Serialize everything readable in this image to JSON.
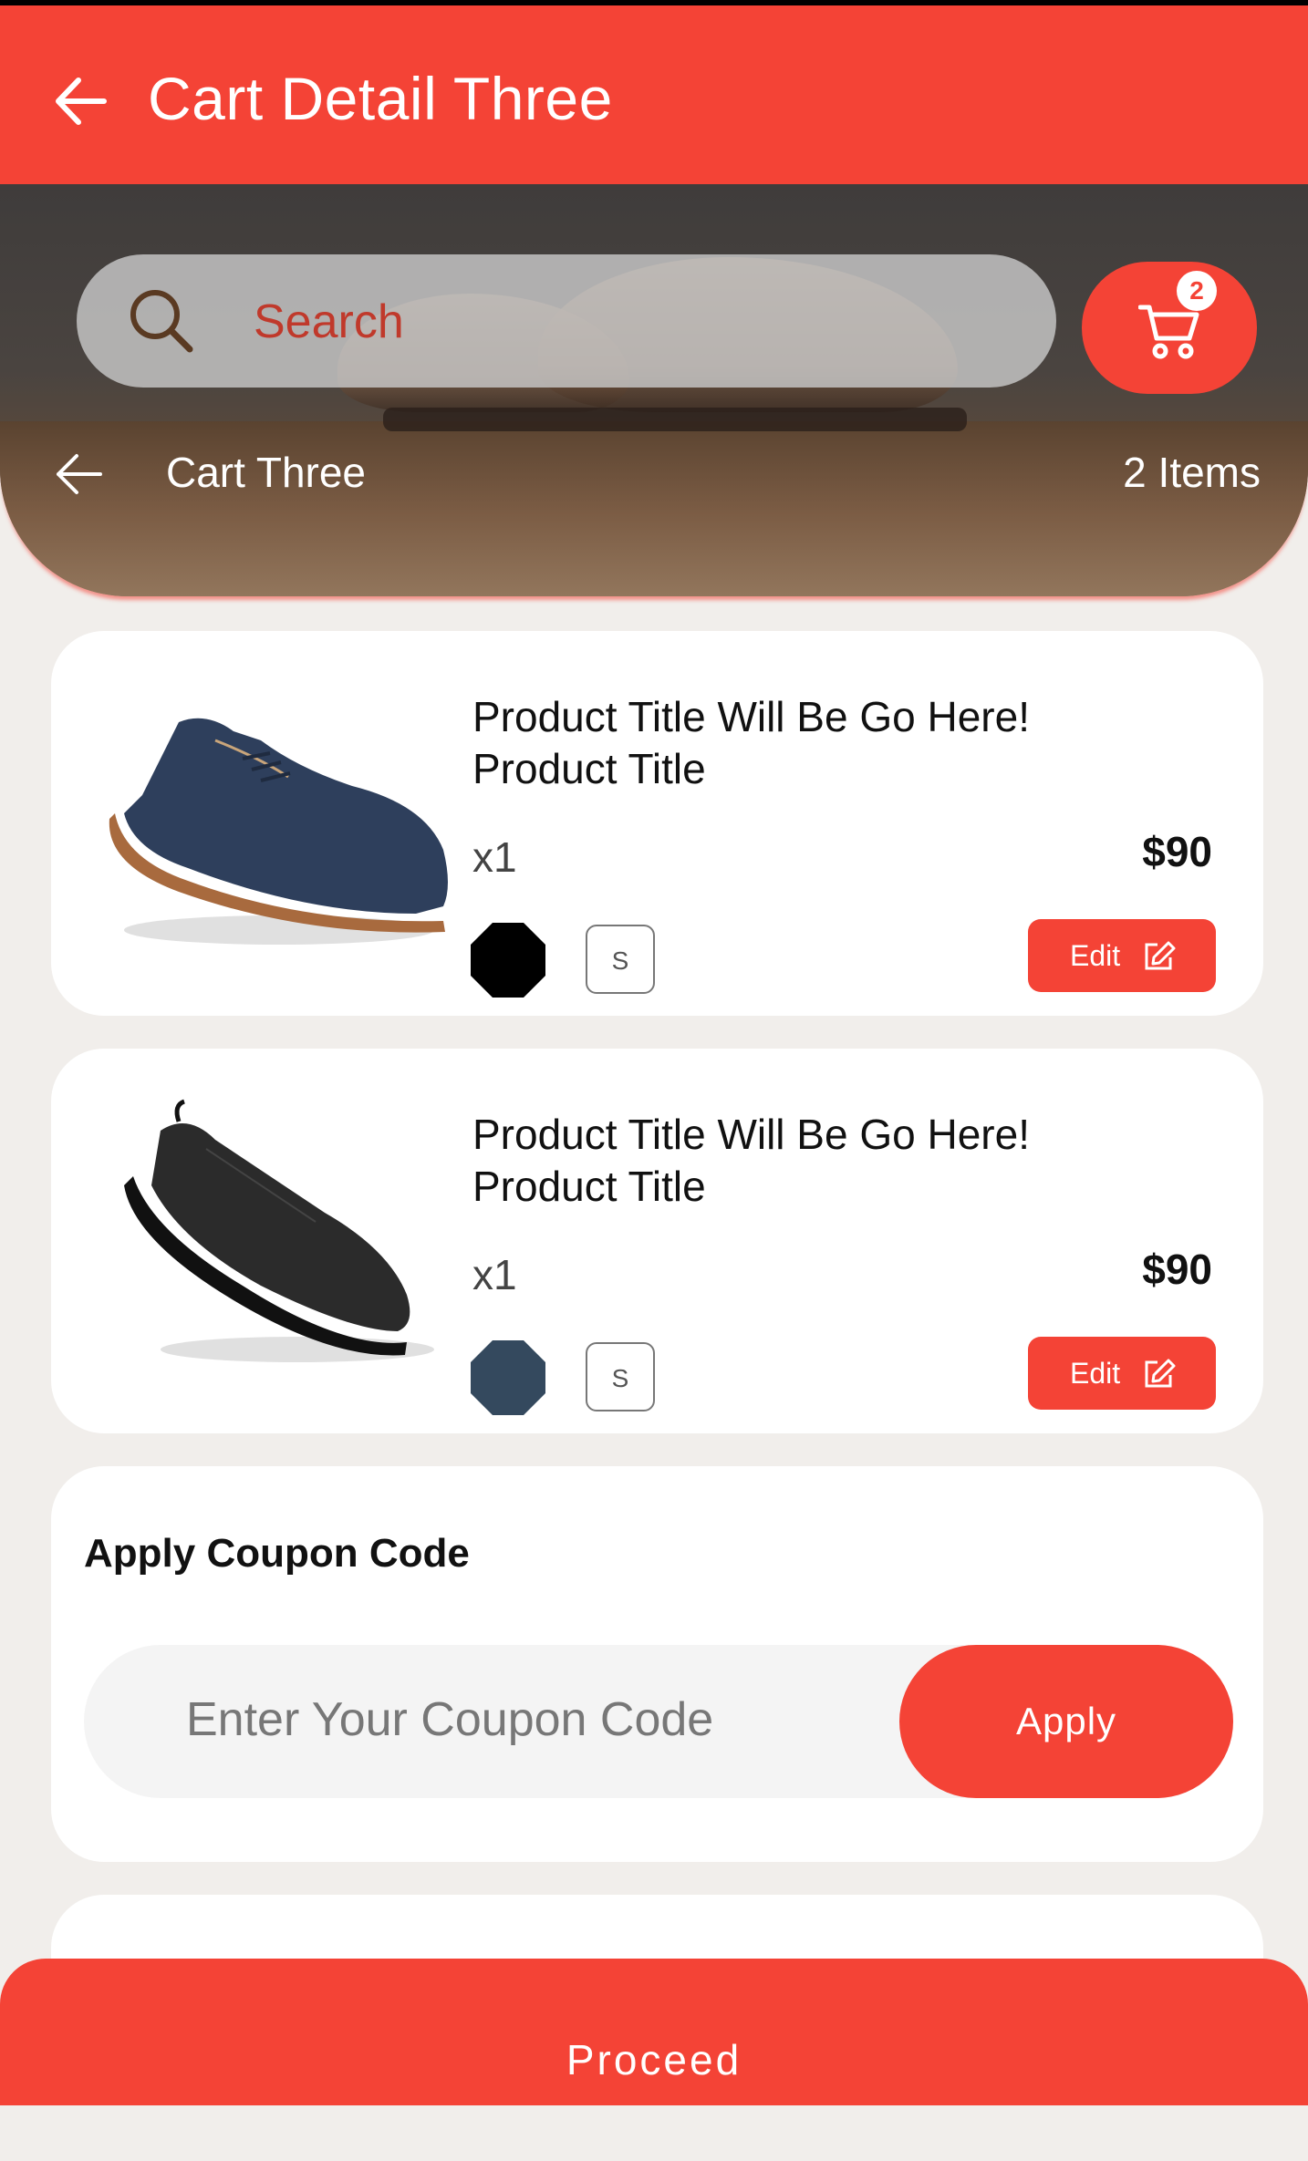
{
  "appbar": {
    "title": "Cart Detail Three",
    "back_icon": "arrow-left-icon"
  },
  "search": {
    "placeholder": "Search",
    "icon": "search-icon"
  },
  "cart": {
    "badge_count": "2",
    "icon": "cart-icon"
  },
  "subnav": {
    "title": "Cart Three",
    "count": "2 Items",
    "back_icon": "arrow-left-icon"
  },
  "products": [
    {
      "title": "Product Title Will Be Go Here! Product Title",
      "qty": "x1",
      "price": "$90",
      "size": "S",
      "color": "#000000",
      "edit_label": "Edit"
    },
    {
      "title": "Product Title Will Be Go Here! Product Title",
      "qty": "x1",
      "price": "$90",
      "size": "S",
      "color": "#34495e",
      "edit_label": "Edit"
    }
  ],
  "coupon": {
    "title": "Apply Coupon Code",
    "placeholder": "Enter Your Coupon Code",
    "apply_label": "Apply"
  },
  "footer": {
    "proceed_label": "Proceed"
  },
  "colors": {
    "accent": "#f44336",
    "background": "#f1eeeb"
  }
}
